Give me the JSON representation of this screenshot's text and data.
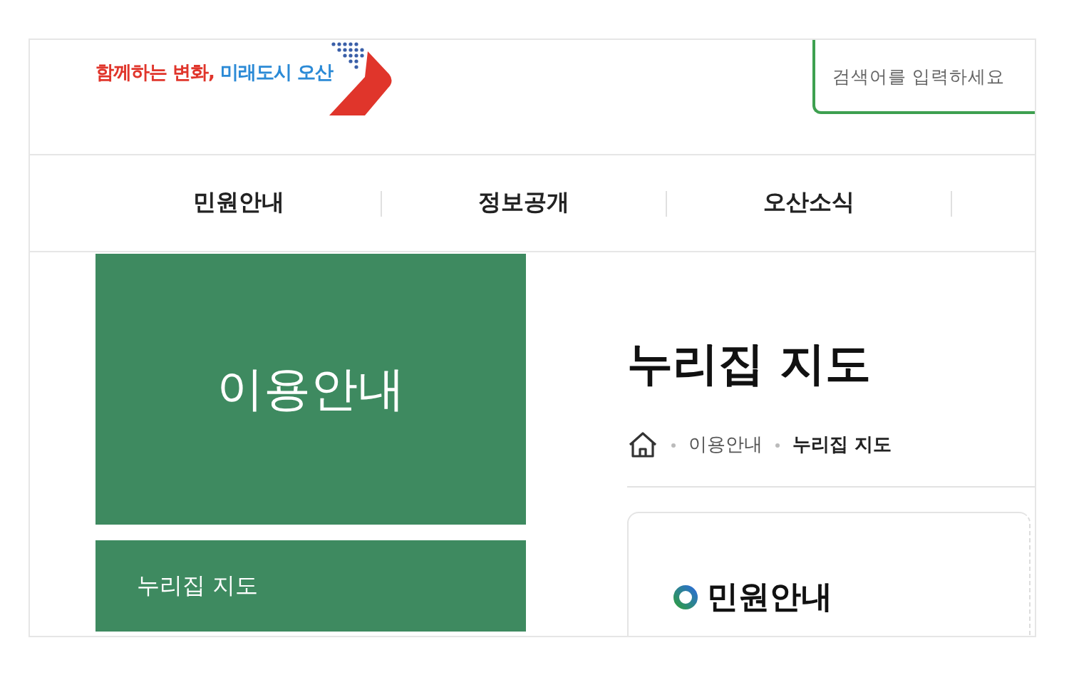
{
  "logo": {
    "slogan_first": "함께하는 변화,",
    "slogan_second": "미래도시 오산"
  },
  "search": {
    "placeholder": "검색어를 입력하세요"
  },
  "nav": {
    "items": [
      "민원안내",
      "정보공개",
      "오산소식"
    ]
  },
  "sidebar": {
    "title": "이용안내",
    "items": [
      "누리집 지도"
    ]
  },
  "page": {
    "title": "누리집 지도",
    "breadcrumb": [
      "이용안내",
      "누리집 지도"
    ],
    "card": {
      "heading": "민원안내"
    }
  }
}
